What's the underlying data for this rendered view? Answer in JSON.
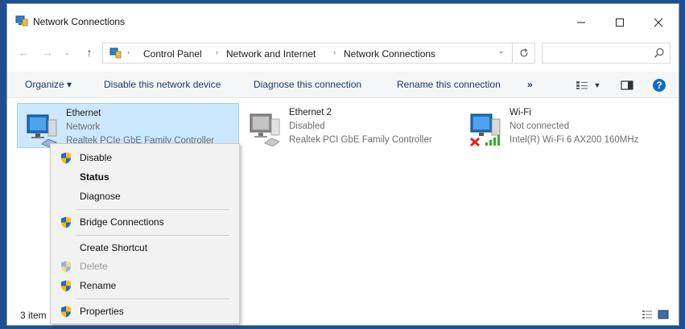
{
  "window": {
    "title": "Network Connections",
    "minimize_icon": "minimize-icon",
    "maximize_icon": "maximize-icon",
    "close_icon": "close-icon"
  },
  "address": {
    "breadcrumbs": [
      "Control Panel",
      "Network and Internet",
      "Network Connections"
    ],
    "search_placeholder": ""
  },
  "commands": {
    "organize": "Organize ▾",
    "disable": "Disable this network device",
    "diagnose": "Diagnose this connection",
    "rename": "Rename this connection",
    "more": "»"
  },
  "adapters": [
    {
      "name": "Ethernet",
      "status": "Network",
      "device": "Realtek PCIe GbE Family Controller",
      "selected": true
    },
    {
      "name": "Ethernet 2",
      "status": "Disabled",
      "device": "Realtek PCI GbE Family Controller",
      "selected": false
    },
    {
      "name": "Wi-Fi",
      "status": "Not connected",
      "device": "Intel(R) Wi-Fi 6 AX200 160MHz",
      "selected": false
    }
  ],
  "statusbar": {
    "count": "3 item"
  },
  "context_menu": {
    "items": [
      {
        "label": "Disable",
        "shield": true
      },
      {
        "label": "Status",
        "bold": true
      },
      {
        "label": "Diagnose"
      },
      {
        "label": "Bridge Connections",
        "shield": true
      },
      {
        "label": "Create Shortcut"
      },
      {
        "label": "Delete",
        "shield": true,
        "disabled": true
      },
      {
        "label": "Rename",
        "shield": true
      },
      {
        "label": "Properties",
        "shield": true
      }
    ]
  },
  "colors": {
    "selection": "#cce8ff",
    "accent": "#0078d7",
    "shield_blue": "#2a62c9",
    "shield_yellow": "#f2c200",
    "error_red": "#d9261c",
    "signal_green": "#3aaa35"
  }
}
